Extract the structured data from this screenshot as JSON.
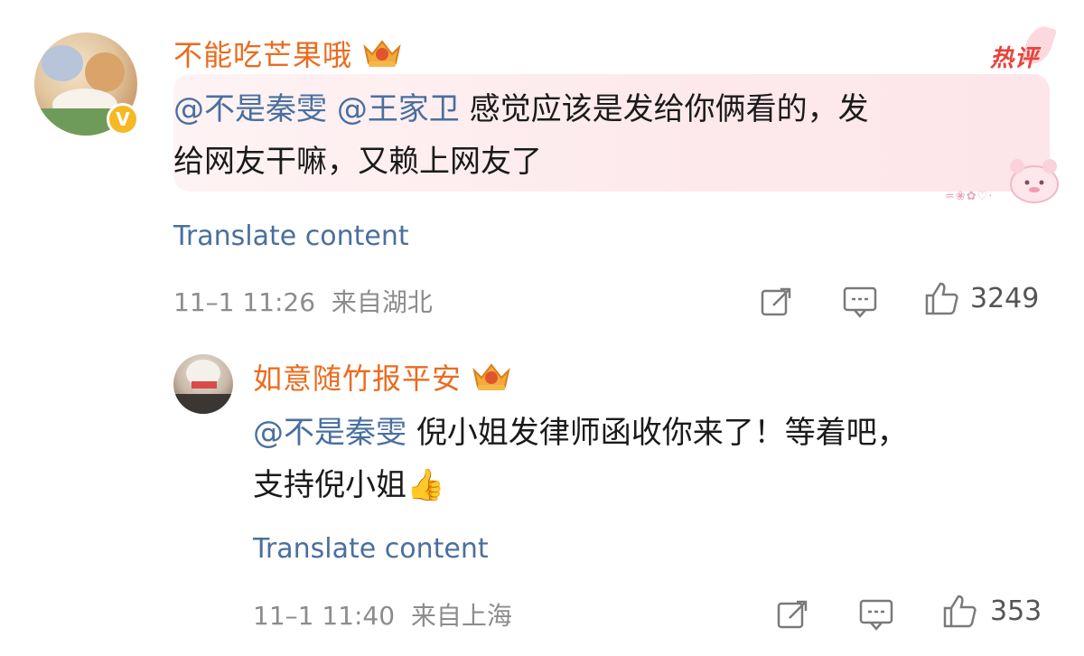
{
  "comment": {
    "username": "不能吃芒果哦",
    "hot_label": "热评",
    "mention1": "@不是秦雯",
    "mention2": "@王家卫",
    "text_part1": "感觉应该是发给你俩看的，发",
    "text_line2": "给网友干嘛，又赖上网友了",
    "translate": "Translate content",
    "time": "11–1 11:26",
    "location": "来自湖北",
    "likes": "3249"
  },
  "reply": {
    "username": "如意随竹报平安",
    "mention": "@不是秦雯",
    "text_part1": "倪小姐发律师函收你来了！等着吧，",
    "text_line2": "支持倪小姐",
    "emoji": "👍",
    "translate": "Translate content",
    "time": "11–1 11:40",
    "location": "来自上海",
    "likes": "353"
  },
  "icons": {
    "verified": "verified-badge-icon",
    "crown": "crown-badge-icon",
    "repost": "repost-icon",
    "comment": "comment-icon",
    "like": "thumbs-up-icon"
  },
  "colors": {
    "username": "#eb6b1e",
    "mention": "#4a6f9e",
    "hot": "#e8433c",
    "meta": "#8c8c8c"
  }
}
